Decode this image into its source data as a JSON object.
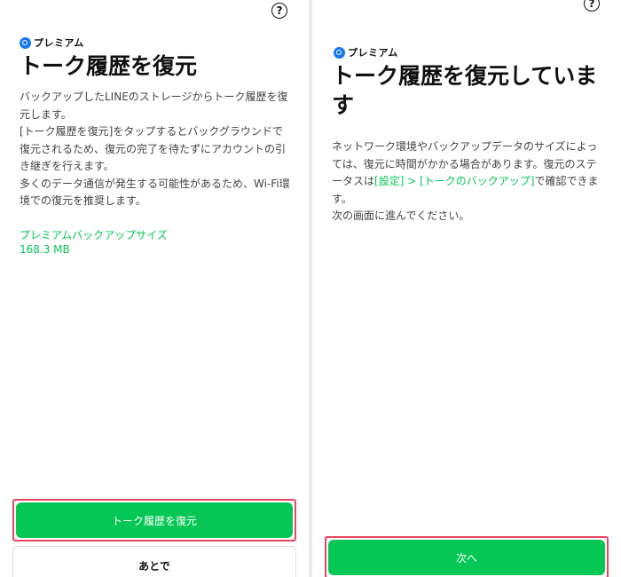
{
  "left": {
    "brand": "プレミアム",
    "help_icon": "?",
    "title": "トーク履歴を復元",
    "description": [
      "バックアップしたLINEのストレージからトーク履歴を復元します。",
      "[トーク履歴を復元]をタップするとバックグラウンドで復元されるため、復元の完了を待たずにアカウントの引き継ぎを行えます。",
      "多くのデータ通信が発生する可能性があるため、Wi-Fi環境での復元を推奨します。"
    ],
    "backup_size_label": "プレミアムバックアップサイズ",
    "backup_size_value": "168.3 MB",
    "restore_button": "トーク履歴を復元",
    "later_button": "あとで"
  },
  "right": {
    "brand": "プレミアム",
    "help_icon": "?",
    "title": "トーク履歴を復元しています",
    "description_before": "ネットワーク環境やバックアップデータのサイズによっては、復元に時間がかかる場合があります。復元のステータスは",
    "description_link": "[設定] > [トークのバックアップ]",
    "description_after": "で確認できます。",
    "description_next": "次の画面に進んでください。",
    "next_button": "次へ"
  },
  "colors": {
    "accent_green": "#06c755",
    "highlight_red": "#e8465e",
    "brand_blue": "#1877f2"
  }
}
